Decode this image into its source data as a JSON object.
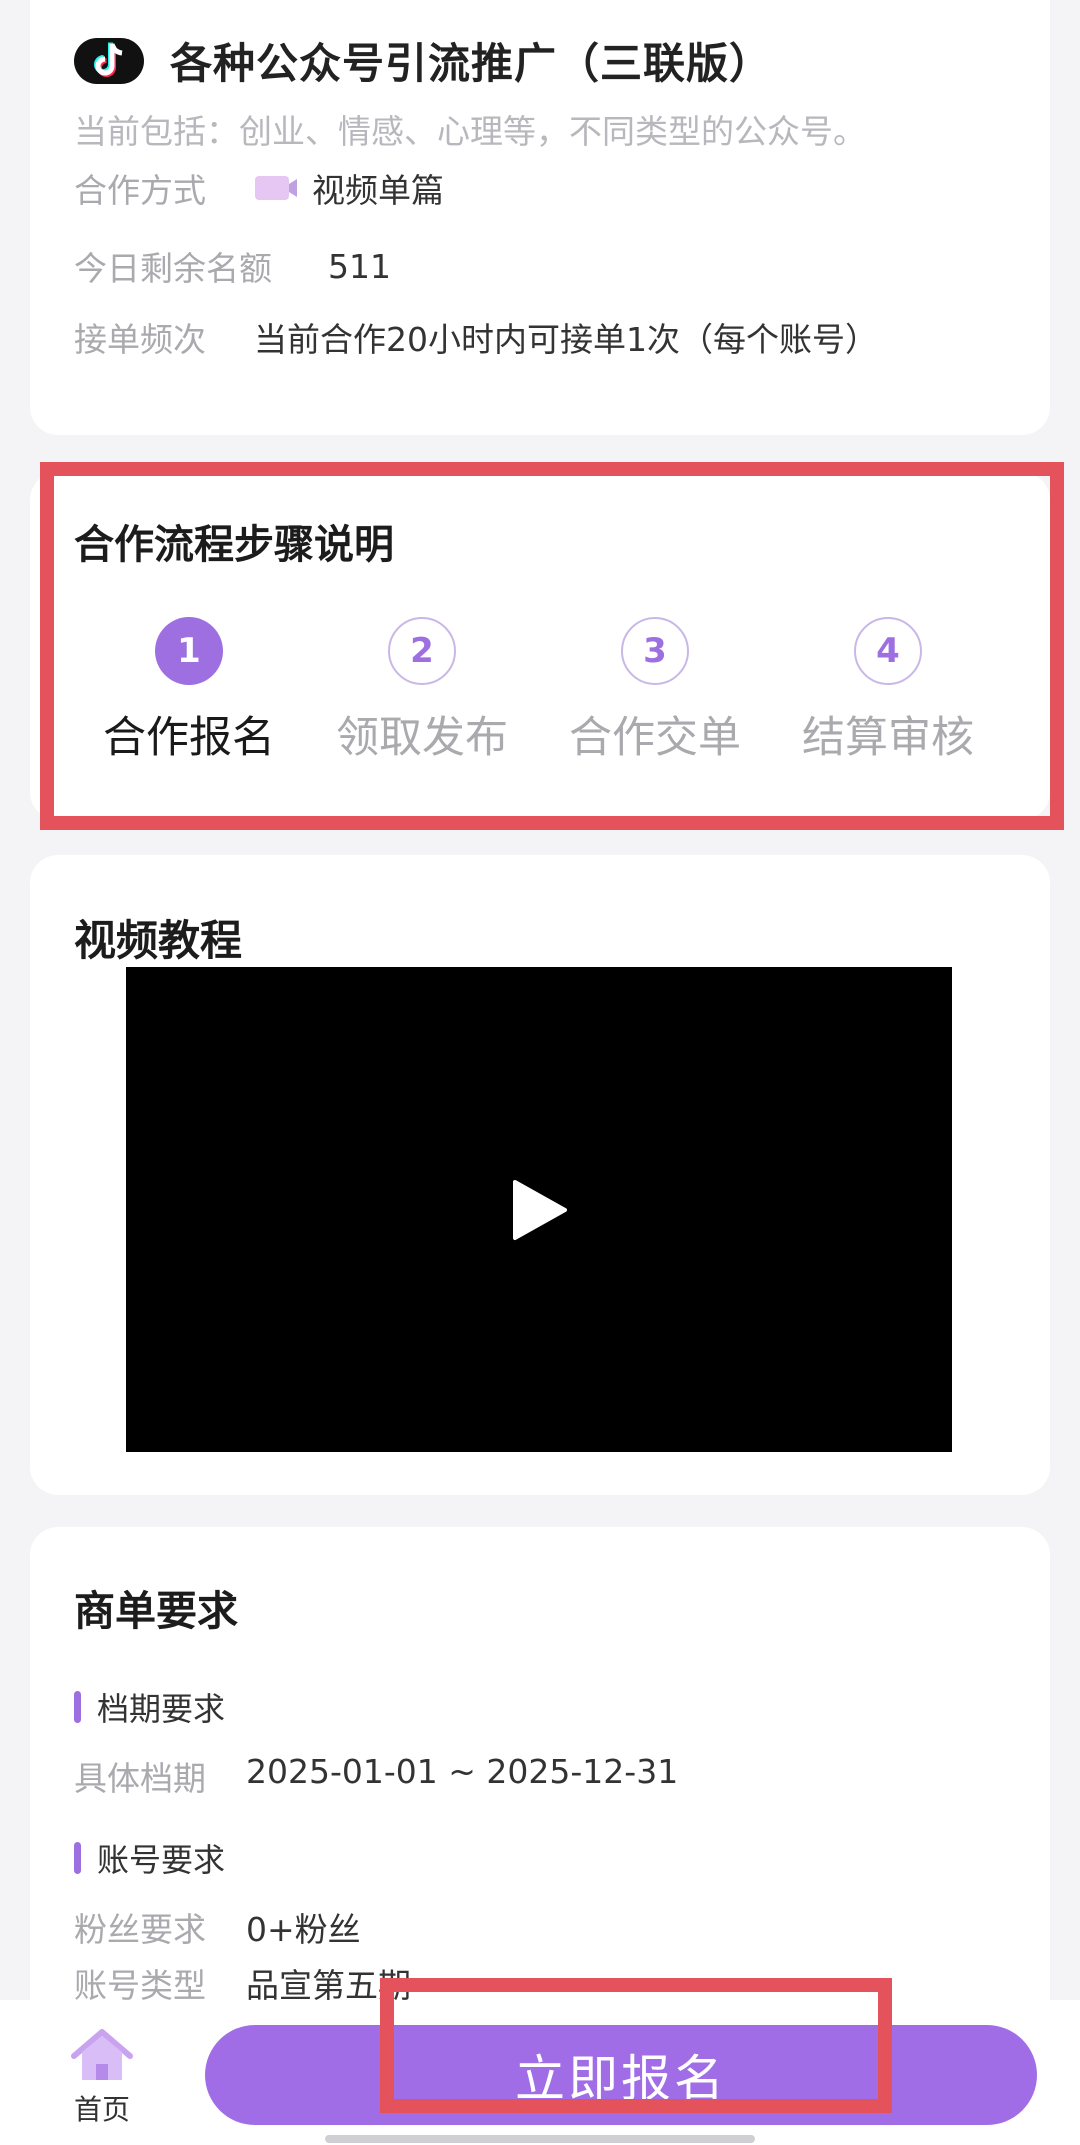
{
  "task_card": {
    "title": "各种公众号引流推广（三联版）",
    "description": "当前包括：创业、情感、心理等，不同类型的公众号。",
    "fields": [
      {
        "label": "合作方式",
        "value": "视频单篇",
        "icon": "video-camera-icon"
      },
      {
        "label": "今日剩余名额",
        "value": "511"
      },
      {
        "label": "接单频次",
        "value": "当前合作20小时内可接单1次（每个账号）"
      }
    ]
  },
  "steps_section": {
    "title": "合作流程步骤说明",
    "steps": [
      {
        "number": "1",
        "label": "合作报名",
        "active": true
      },
      {
        "number": "2",
        "label": "领取发布",
        "active": false
      },
      {
        "number": "3",
        "label": "合作交单",
        "active": false
      },
      {
        "number": "4",
        "label": "结算审核",
        "active": false
      }
    ]
  },
  "video_section": {
    "title": "视频教程"
  },
  "requirements_section": {
    "title": "商单要求",
    "groups": [
      {
        "heading": "档期要求",
        "items": [
          {
            "label": "具体档期",
            "value": "2025-01-01 ~ 2025-12-31"
          }
        ]
      },
      {
        "heading": "账号要求",
        "items": [
          {
            "label": "粉丝要求",
            "value": "0+粉丝"
          },
          {
            "label": "账号类型",
            "value": "品宣第五期"
          }
        ]
      }
    ]
  },
  "bottom_bar": {
    "home_label": "首页",
    "signup_button": "立即报名"
  },
  "colors": {
    "accent": "#9e6fe0",
    "button": "#a06de6",
    "highlight": "#e4525c",
    "background": "#f4f3f6"
  }
}
